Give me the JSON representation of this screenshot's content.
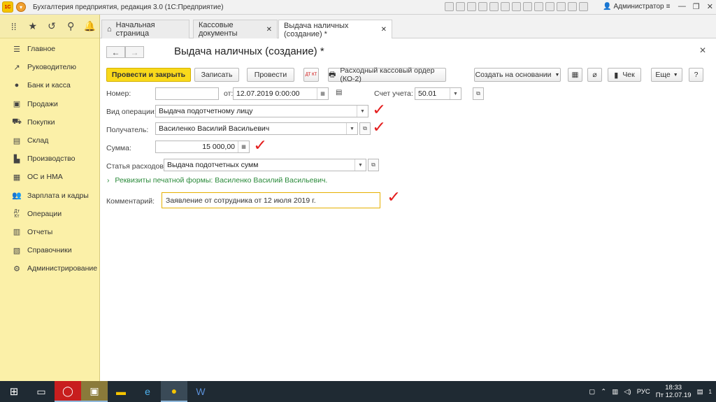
{
  "window": {
    "title": "Бухгалтерия предприятия, редакция 3.0  (1С:Предприятие)",
    "user": "Администратор",
    "logo": "1С"
  },
  "sidebar": {
    "items": [
      {
        "label": "Главное",
        "icon": "menu-lines-icon"
      },
      {
        "label": "Руководителю",
        "icon": "chart-line-icon"
      },
      {
        "label": "Банк и касса",
        "icon": "coin-icon"
      },
      {
        "label": "Продажи",
        "icon": "bag-icon"
      },
      {
        "label": "Покупки",
        "icon": "cart-icon"
      },
      {
        "label": "Склад",
        "icon": "box-icon"
      },
      {
        "label": "Производство",
        "icon": "factory-icon"
      },
      {
        "label": "ОС и НМА",
        "icon": "assets-icon"
      },
      {
        "label": "Зарплата и кадры",
        "icon": "people-icon"
      },
      {
        "label": "Операции",
        "icon": "dt-kt-icon"
      },
      {
        "label": "Отчеты",
        "icon": "bar-chart-icon"
      },
      {
        "label": "Справочники",
        "icon": "books-icon"
      },
      {
        "label": "Администрирование",
        "icon": "gear-icon"
      }
    ]
  },
  "tabs": [
    {
      "label": "Начальная страница"
    },
    {
      "label": "Кассовые документы"
    },
    {
      "label": "Выдача наличных (создание) *"
    }
  ],
  "form": {
    "title": "Выдача наличных (создание) *",
    "buttons": {
      "post_close": "Провести и закрыть",
      "save": "Записать",
      "post": "Провести",
      "dtkt": "ДТ КТ",
      "print": "Расходный кассовый ордер (КО-2)",
      "create_based": "Создать на основании",
      "check": "Чек",
      "more": "Еще",
      "help": "?"
    },
    "number_label": "Номер:",
    "number_value": "",
    "date_label": "от:",
    "date_value": "12.07.2019  0:00:00",
    "account_label": "Счет учета:",
    "account_value": "50.01",
    "operation_label": "Вид операции:",
    "operation_value": "Выдача подотчетному лицу",
    "recipient_label": "Получатель:",
    "recipient_value": "Василенко Василий Васильевич",
    "sum_label": "Сумма:",
    "sum_value": "15 000,00",
    "expense_label": "Статья расходов:",
    "expense_value": "Выдача подотчетных сумм",
    "print_details_link": "Реквизиты печатной формы: Василенко Василий Васильевич.",
    "comment_label": "Комментарий:",
    "comment_value": "Заявление от сотрудника от 12 июля 2019 г."
  },
  "taskbar": {
    "lang": "РУС",
    "time": "18:33",
    "date": "Пт 12.07.19",
    "notification_count": "1"
  },
  "colors": {
    "sidebar_bg": "#fbf0a8",
    "primary_button": "#f9d91b",
    "checkmark": "#e41e1e",
    "link": "#2a8a3a"
  }
}
